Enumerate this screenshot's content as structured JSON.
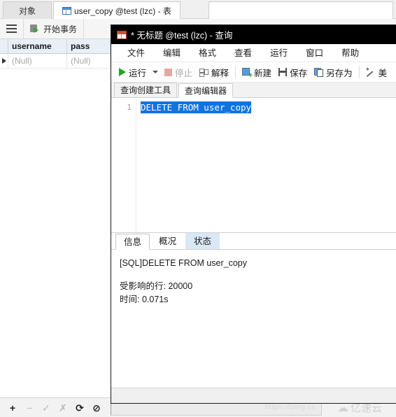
{
  "main_window": {
    "tabs": [
      {
        "label": "对象",
        "name": "tab-objects",
        "active": false
      },
      {
        "label": "user_copy @test (lzc) - 表",
        "name": "tab-usercopy",
        "active": true
      }
    ],
    "toolbar": {
      "menu_icon": "hamburger-icon",
      "begin_transaction_label": "开始事务"
    },
    "grid": {
      "columns": [
        "username",
        "pass"
      ],
      "rows": [
        [
          "(Null)",
          "(Null)"
        ]
      ]
    },
    "statusbar": {
      "buttons": [
        {
          "name": "add-record-button",
          "glyph": "+",
          "enabled": true
        },
        {
          "name": "remove-record-button",
          "glyph": "−",
          "enabled": false
        },
        {
          "name": "apply-change-button",
          "glyph": "✓",
          "enabled": false
        },
        {
          "name": "cancel-change-button",
          "glyph": "✗",
          "enabled": false
        },
        {
          "name": "refresh-button",
          "glyph": "⟳",
          "enabled": true
        },
        {
          "name": "stop-button",
          "glyph": "⊘",
          "enabled": true
        }
      ],
      "filter_value": "",
      "watermark_url": "https://blog.cs",
      "watermark_brand": "亿速云"
    }
  },
  "query_window": {
    "title": "* 无标题 @test (lzc) - 查询",
    "menu": [
      "文件",
      "编辑",
      "格式",
      "查看",
      "运行",
      "窗口",
      "帮助"
    ],
    "toolbar": [
      {
        "label": "运行",
        "icon": "play-icon",
        "enabled": true,
        "has_caret": true
      },
      {
        "label": "停止",
        "icon": "stop-icon",
        "enabled": false
      },
      {
        "label": "解释",
        "icon": "explain-icon",
        "enabled": true
      },
      {
        "label": "新建",
        "icon": "new-query-icon",
        "enabled": true
      },
      {
        "label": "保存",
        "icon": "save-icon",
        "enabled": true
      },
      {
        "label": "另存为",
        "icon": "save-as-icon",
        "enabled": true
      },
      {
        "label": "美",
        "icon": "beautify-wand-icon",
        "enabled": true
      }
    ],
    "editor_tabs": [
      {
        "label": "查询创建工具",
        "active": false
      },
      {
        "label": "查询编辑器",
        "active": true
      }
    ],
    "editor": {
      "line_number": "1",
      "sql": "DELETE FROM user_copy",
      "selected": true
    },
    "result_tabs": [
      {
        "label": "信息",
        "active": true,
        "highlighted": false
      },
      {
        "label": "概况",
        "active": false,
        "highlighted": false
      },
      {
        "label": "状态",
        "active": false,
        "highlighted": true
      }
    ],
    "result_output": {
      "sql_line": "[SQL]DELETE FROM user_copy",
      "affected_rows": "受影响的行: 20000",
      "time": "时间: 0.071s"
    }
  },
  "colors": {
    "selection_blue": "#1273de",
    "title_black": "#000000",
    "accent_green": "#22a422",
    "tab_highlight": "#d9e8f5"
  }
}
